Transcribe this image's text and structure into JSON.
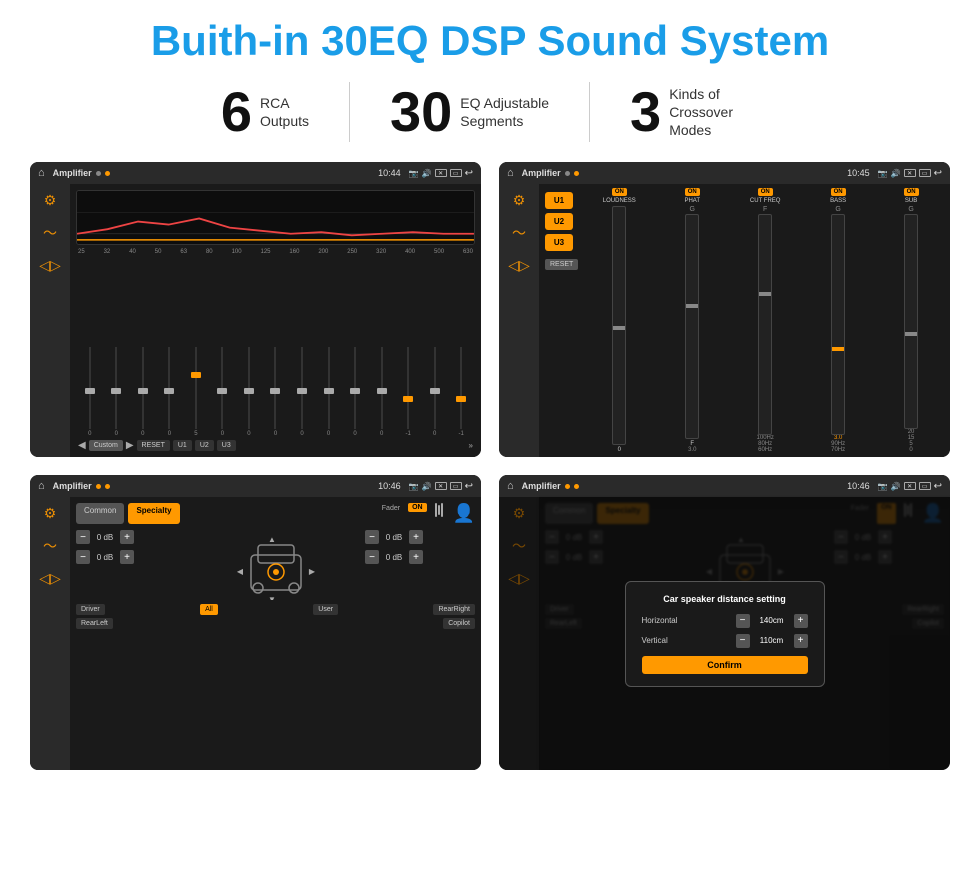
{
  "header": {
    "title": "Buith-in 30EQ DSP Sound System"
  },
  "stats": [
    {
      "number": "6",
      "text_line1": "RCA",
      "text_line2": "Outputs"
    },
    {
      "number": "30",
      "text_line1": "EQ Adjustable",
      "text_line2": "Segments"
    },
    {
      "number": "3",
      "text_line1": "Kinds of",
      "text_line2": "Crossover Modes"
    }
  ],
  "screens": [
    {
      "id": "screen1",
      "status_bar": {
        "title": "Amplifier",
        "time": "10:44"
      }
    },
    {
      "id": "screen2",
      "status_bar": {
        "title": "Amplifier",
        "time": "10:45"
      }
    },
    {
      "id": "screen3",
      "status_bar": {
        "title": "Amplifier",
        "time": "10:46"
      }
    },
    {
      "id": "screen4",
      "status_bar": {
        "title": "Amplifier",
        "time": "10:46"
      },
      "dialog": {
        "title": "Car speaker distance setting",
        "horizontal_label": "Horizontal",
        "horizontal_value": "140cm",
        "vertical_label": "Vertical",
        "vertical_value": "110cm",
        "confirm_label": "Confirm"
      }
    }
  ],
  "eq": {
    "freqs": [
      "25",
      "32",
      "40",
      "50",
      "63",
      "80",
      "100",
      "125",
      "160",
      "200",
      "250",
      "320",
      "400",
      "500",
      "630"
    ],
    "values": [
      "0",
      "0",
      "0",
      "0",
      "5",
      "0",
      "0",
      "0",
      "0",
      "0",
      "0",
      "0",
      "-1",
      "0",
      "-1"
    ],
    "buttons": [
      "Custom",
      "RESET",
      "U1",
      "U2",
      "U3"
    ]
  },
  "crossover": {
    "u_buttons": [
      "U1",
      "U2",
      "U3"
    ],
    "channels": [
      "LOUDNESS",
      "PHAT",
      "CUT FREQ",
      "BASS",
      "SUB"
    ],
    "reset_label": "RESET"
  },
  "fader": {
    "tabs": [
      "Common",
      "Specialty"
    ],
    "fader_label": "Fader",
    "on_label": "ON",
    "db_values": [
      "0 dB",
      "0 dB",
      "0 dB",
      "0 dB"
    ],
    "bottom_labels": [
      "Driver",
      "All",
      "User",
      "RearRight",
      "RearLeft",
      "Copilot"
    ]
  }
}
